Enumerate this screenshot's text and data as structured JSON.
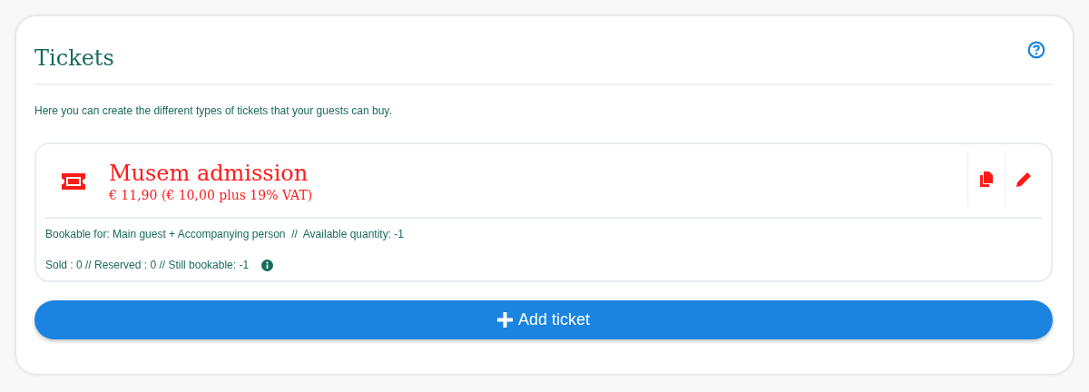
{
  "panel": {
    "title": "Tickets",
    "description": "Here you can create the different types of tickets that your guests can buy."
  },
  "tickets": [
    {
      "name": "Musem admission",
      "price": "€ 11,90 (€ 10,00 plus 19% VAT)",
      "bookable": "Bookable for: Main guest + Accompanying person  //  Available quantity: -1",
      "stats": "Sold : 0 // Reserved : 0 // Still bookable: -1"
    }
  ],
  "add_button": "Add ticket"
}
